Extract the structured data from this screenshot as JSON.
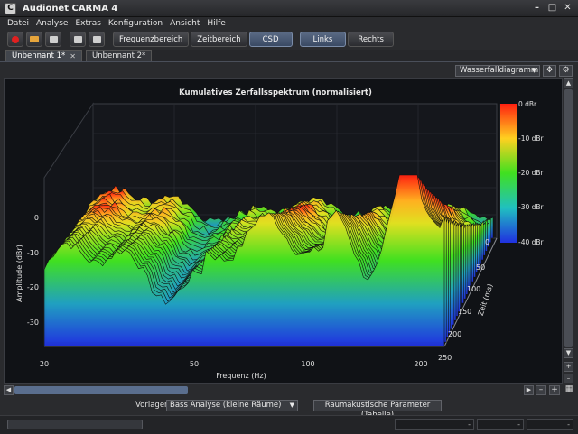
{
  "window": {
    "title": "Audionet CARMA 4",
    "app_icon_letter": "C"
  },
  "menu": [
    "Datei",
    "Analyse",
    "Extras",
    "Konfiguration",
    "Ansicht",
    "Hilfe"
  ],
  "toolbar": {
    "buttons": [
      "Frequenzbereich",
      "Zeitbereich",
      "CSD"
    ],
    "active_button": "CSD",
    "channels": [
      "Links",
      "Rechts"
    ],
    "active_channel": "Links"
  },
  "tabs": [
    {
      "label": "Unbennant 1*",
      "active": true,
      "closable": true
    },
    {
      "label": "Unbennant 2*",
      "active": false,
      "closable": false
    }
  ],
  "view": {
    "selected": "Wasserfalldiagramm"
  },
  "chart_data": {
    "type": "waterfall",
    "title": "Kumulatives Zerfallsspektrum (normalisiert)",
    "xlabel": "Frequenz (Hz)",
    "ylabel": "Amplitude (dBr)",
    "zlabel": "Zeit (ms)",
    "x_ticks": [
      "20",
      "50",
      "100",
      "200"
    ],
    "y_ticks": [
      "0",
      "-10",
      "-20",
      "-30"
    ],
    "z_ticks": [
      "0",
      "50",
      "100",
      "150",
      "200",
      "250"
    ],
    "colorbar": [
      "0 dBr",
      "-10 dBr",
      "-20 dBr",
      "-30 dBr",
      "-40 dBr"
    ],
    "colors": [
      "#ff2010",
      "#ffd020",
      "#40e020",
      "#20c0c0",
      "#2030e0"
    ]
  },
  "bottom": {
    "templates_label": "Vorlagen",
    "templates_selected": "Bass Analyse (kleine Räume)",
    "param_button": "Raumakustische Parameter (Tabelle)"
  },
  "status": {
    "field1": "-",
    "field2": "-",
    "field3": "-"
  }
}
